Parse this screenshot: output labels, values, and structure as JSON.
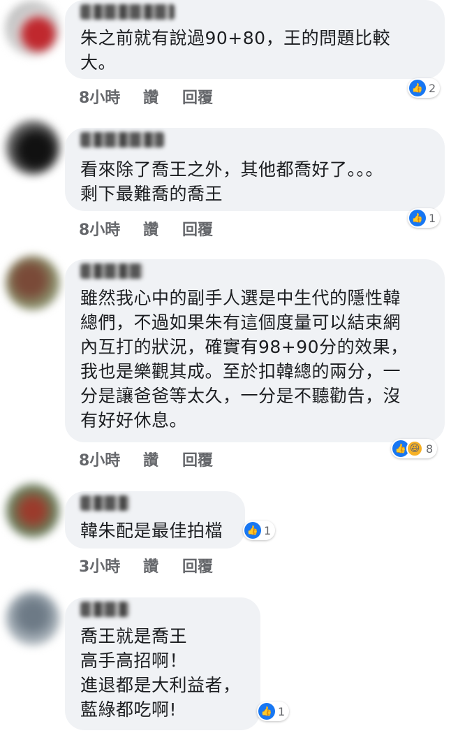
{
  "comments": [
    {
      "lines": [
        "朱之前就有說過90+80，王的問題比較",
        "大。"
      ],
      "time": "8小時",
      "like_label": "讚",
      "reply_label": "回覆",
      "reaction_count": "2"
    },
    {
      "lines": [
        "看來除了喬王之外，其他都喬好了。。。",
        "剩下最難喬的喬王"
      ],
      "time": "8小時",
      "like_label": "讚",
      "reply_label": "回覆",
      "reaction_count": "1"
    },
    {
      "lines": [
        "雖然我心中的副手人選是中生代的隱性韓",
        "總們，不過如果朱有這個度量可以結束網",
        "內互打的狀況，確實有98+90分的效果，",
        "我也是樂觀其成。至於扣韓總的兩分，一",
        "分是讓爸爸等太久，一分是不聽勸告，沒",
        "有好好休息。"
      ],
      "time": "8小時",
      "like_label": "讚",
      "reply_label": "回覆",
      "reaction_count": "8"
    },
    {
      "lines": [
        "韓朱配是最佳拍檔"
      ],
      "time": "3小時",
      "like_label": "讚",
      "reply_label": "回覆",
      "reaction_count": "1"
    },
    {
      "lines": [
        "喬王就是喬王",
        "高手高招啊！",
        "進退都是大利益者，",
        "藍綠都吃啊!"
      ],
      "reaction_count": "1"
    }
  ],
  "icons": {
    "like": "thumbs-up-icon",
    "haha": "laughing-face-icon"
  },
  "colors": {
    "bubble": "#f0f2f5",
    "like_blue": "#1877f2",
    "meta_text": "#65676b"
  }
}
